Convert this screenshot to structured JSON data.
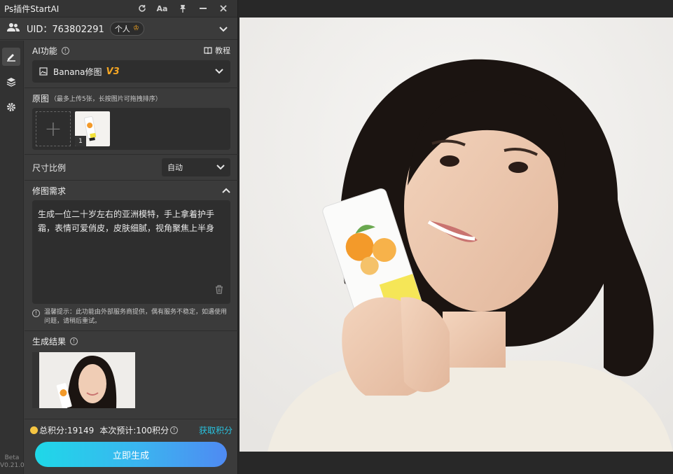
{
  "window": {
    "title": "Ps插件StartAI"
  },
  "titlebar_icons": [
    "refresh-icon",
    "font-size-icon",
    "pin-icon",
    "minimize-icon",
    "close-icon"
  ],
  "titlebar": {
    "font_label": "Aa"
  },
  "user": {
    "uid": "UID：763802291",
    "badge": "个人"
  },
  "rail": {
    "items": [
      "edit-icon",
      "layers-icon",
      "settings-icon"
    ],
    "version_line1": "Beta",
    "version_line2": "V0.21.0"
  },
  "ai": {
    "label": "AI功能",
    "tutorial": "教程",
    "model": "Banana修图",
    "model_version": "V3"
  },
  "original": {
    "label": "原图",
    "note": "（最多上传5张，长按图片可拖拽排序）",
    "thumb_index": "1"
  },
  "ratio": {
    "label": "尺寸比例",
    "value": "自动"
  },
  "prompt": {
    "label": "修图需求",
    "text": "生成一位二十岁左右的亚洲模特，手上拿着护手霜，表情可爱俏皮，皮肤细腻，视角聚焦上半身",
    "tip": "温馨提示：此功能由外部服务商提供，偶有服务不稳定，如遇使用问题，请稍后重试。"
  },
  "result": {
    "label": "生成结果"
  },
  "points": {
    "total": "总积分:19149",
    "estimate": "本次预计:100积分",
    "get_label": "获取积分"
  },
  "generate_button": "立即生成",
  "colors": {
    "accent": "#28c3e0",
    "version_badge": "#f5a623",
    "panel_bg": "#3b3b3b",
    "field_bg": "#2e2e2e"
  }
}
